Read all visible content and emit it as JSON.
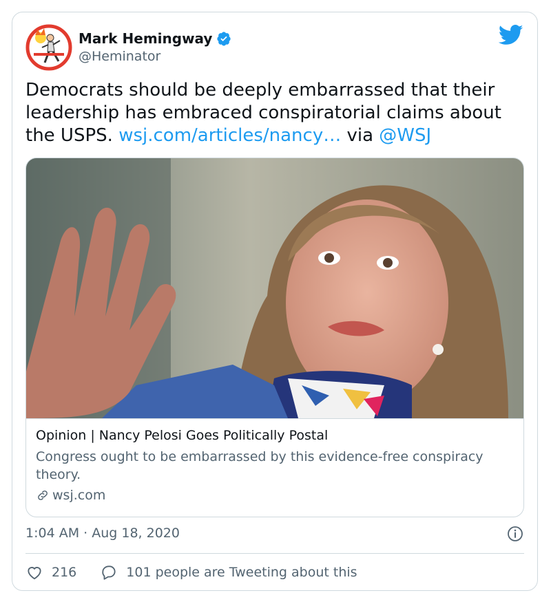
{
  "author": {
    "name": "Mark Hemingway",
    "handle": "@Heminator",
    "verified_icon": "verified-badge-icon"
  },
  "tweet": {
    "text_main": "Democrats should be deeply embarrassed that their leadership has embraced conspiratorial claims about the USPS. ",
    "link_text": "wsj.com/articles/nancy…",
    "via_text": " via ",
    "mention": "@WSJ"
  },
  "link_card": {
    "title": "Opinion | Nancy Pelosi Goes Politically Postal",
    "description": "Congress ought to be embarrassed by this evidence-free conspiracy theory.",
    "domain": "wsj.com"
  },
  "timestamp": "1:04 AM · Aug 18, 2020",
  "actions": {
    "likes": "216",
    "replies_text": "101 people are Tweeting about this"
  },
  "colors": {
    "link": "#1d9bf0",
    "secondary": "#536471",
    "border": "#cfd9de",
    "like_accent": "#e0245e"
  }
}
